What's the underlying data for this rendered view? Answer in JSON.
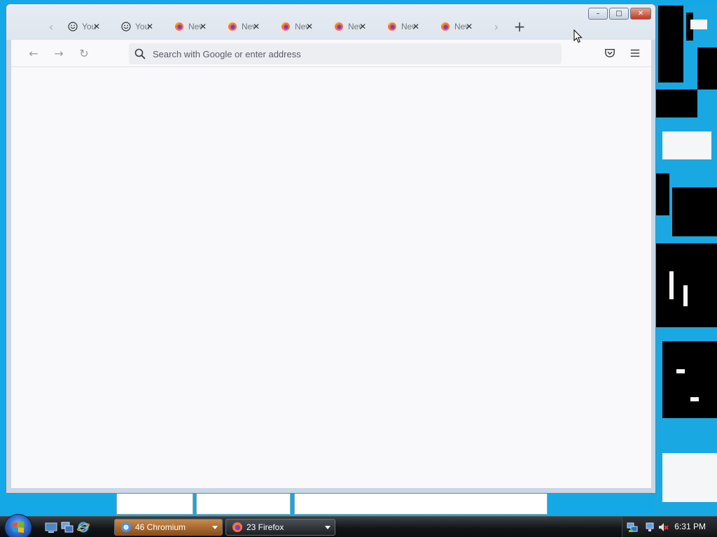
{
  "browser": {
    "tabs": [
      {
        "label": "YouTube",
        "icon": "smiley-icon"
      },
      {
        "label": "YouTube",
        "icon": "smiley-icon"
      },
      {
        "label": "New Tab",
        "icon": "firefox-icon"
      },
      {
        "label": "New Tab",
        "icon": "firefox-icon"
      },
      {
        "label": "New Tab",
        "icon": "firefox-icon"
      },
      {
        "label": "New Tab",
        "icon": "firefox-icon"
      },
      {
        "label": "New Tab",
        "icon": "firefox-icon"
      },
      {
        "label": "New Tab",
        "icon": "firefox-icon"
      }
    ],
    "urlbar_placeholder": "Search with Google or enter address",
    "win_minimize": "–",
    "win_maximize": "□",
    "win_close": "✕",
    "tab_close": "✕",
    "new_tab": "+",
    "scroll_left": "‹",
    "scroll_right": "›",
    "back": "←",
    "forward": "→",
    "reload": "↻"
  },
  "taskbar": {
    "buttons": [
      {
        "label": "46 Chromium",
        "icon": "chromium-icon"
      },
      {
        "label": "23 Firefox",
        "icon": "firefox-icon"
      }
    ],
    "clock": "6:31 PM"
  },
  "colors": {
    "desktop": "#14a9e6",
    "accent_firefox": "#ff7139",
    "chromium_active": "#b86a2a"
  }
}
